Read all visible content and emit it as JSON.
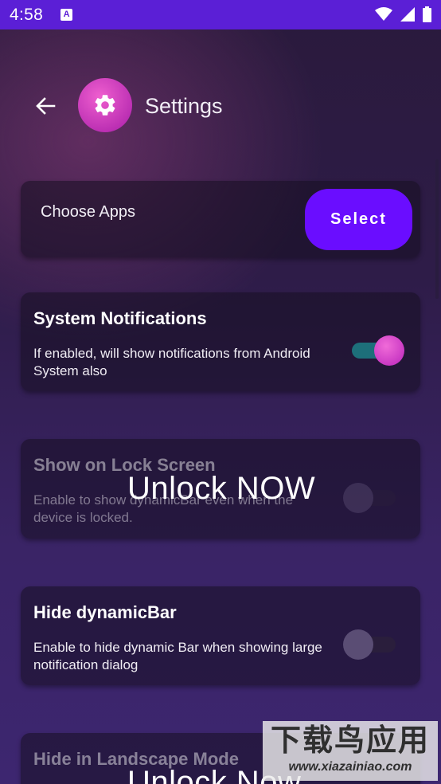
{
  "status_bar": {
    "time": "4:58",
    "app_icon": "A",
    "icons": [
      "wifi-icon",
      "signal-icon",
      "battery-icon"
    ]
  },
  "header": {
    "title": "Settings",
    "back_icon": "arrow-left-icon",
    "logo_icon": "gear-icon"
  },
  "choose_apps": {
    "label": "Choose Apps",
    "button_label": "Select"
  },
  "settings": [
    {
      "title": "System Notifications",
      "description": "If enabled, will show notifications from Android System also",
      "enabled": true,
      "disabled": false
    },
    {
      "title": "Show on Lock Screen",
      "description": "Enable to show dynamicBar even when the device is locked.",
      "enabled": false,
      "disabled": true,
      "overlay": "Unlock NOW"
    },
    {
      "title": "Hide dynamicBar",
      "description": "Enable to hide dynamic Bar when showing large notification dialog",
      "enabled": false,
      "disabled": false
    },
    {
      "title": "Hide in Landscape Mode",
      "disabled": true,
      "overlay": "Unlock Now"
    }
  ],
  "watermark": {
    "text": "下载鸟应用",
    "url": "www.xiazainiao.com"
  },
  "colors": {
    "status_bar": "#5b1fd6",
    "select_button": "#6a0dff",
    "toggle_on_track": "#1d6f7a",
    "toggle_on_thumb": "#e052cf",
    "toggle_off_thumb": "#5a4d74"
  }
}
